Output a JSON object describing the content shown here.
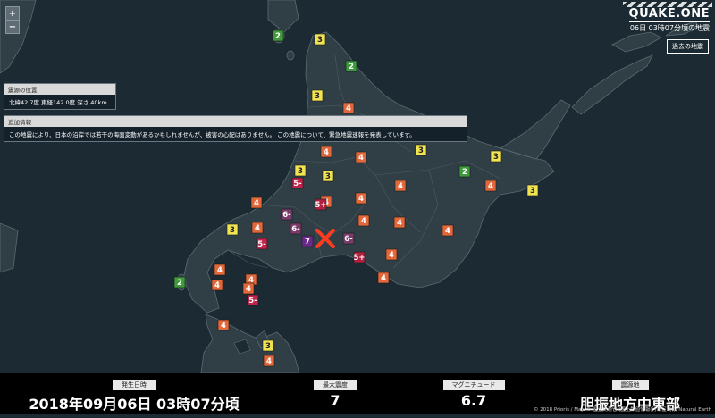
{
  "map": {
    "zoom_in": "+",
    "zoom_out": "−",
    "epicenter_marker": "x-mark-icon",
    "stations": [
      {
        "label": "2",
        "color": "#3e9a3a",
        "text_color": "#ffffff"
      },
      {
        "label": "3",
        "color": "#f2e450",
        "text_color": "#222222"
      },
      {
        "label": "2",
        "color": "#3e9a3a",
        "text_color": "#ffffff"
      },
      {
        "label": "3",
        "color": "#f2e450",
        "text_color": "#222222"
      },
      {
        "label": "4",
        "color": "#e2673b",
        "text_color": "#ffffff"
      },
      {
        "label": "3",
        "color": "#f2e450",
        "text_color": "#222222"
      },
      {
        "label": "4",
        "color": "#e2673b",
        "text_color": "#ffffff"
      },
      {
        "label": "3",
        "color": "#f2e450",
        "text_color": "#222222"
      },
      {
        "label": "4",
        "color": "#e2673b",
        "text_color": "#ffffff"
      },
      {
        "label": "4",
        "color": "#e2673b",
        "text_color": "#ffffff"
      },
      {
        "label": "3",
        "color": "#f2e450",
        "text_color": "#222222"
      },
      {
        "label": "3",
        "color": "#f2e450",
        "text_color": "#222222"
      },
      {
        "label": "2",
        "color": "#3e9a3a",
        "text_color": "#ffffff"
      },
      {
        "label": "3",
        "color": "#f2e450",
        "text_color": "#222222"
      },
      {
        "label": "5-",
        "color": "#c0224a",
        "text_color": "#ffffff"
      },
      {
        "label": "4",
        "color": "#e2673b",
        "text_color": "#ffffff"
      },
      {
        "label": "4",
        "color": "#e2673b",
        "text_color": "#ffffff"
      },
      {
        "label": "4",
        "color": "#e2673b",
        "text_color": "#ffffff"
      },
      {
        "label": "4",
        "color": "#e2673b",
        "text_color": "#ffffff"
      },
      {
        "label": "3",
        "color": "#f2e450",
        "text_color": "#222222"
      },
      {
        "label": "5+",
        "color": "#b02040",
        "text_color": "#ffffff"
      },
      {
        "label": "4",
        "color": "#e2673b",
        "text_color": "#ffffff"
      },
      {
        "label": "4",
        "color": "#e2673b",
        "text_color": "#ffffff"
      },
      {
        "label": "6-",
        "color": "#7a3a6a",
        "text_color": "#ffffff"
      },
      {
        "label": "6-",
        "color": "#7a3a6a",
        "text_color": "#ffffff"
      },
      {
        "label": "7",
        "color": "#6a2a8a",
        "text_color": "#ffffff"
      },
      {
        "label": "6-",
        "color": "#7a3a6a",
        "text_color": "#ffffff"
      },
      {
        "label": "3",
        "color": "#f2e450",
        "text_color": "#222222"
      },
      {
        "label": "4",
        "color": "#e2673b",
        "text_color": "#ffffff"
      },
      {
        "label": "4",
        "color": "#e2673b",
        "text_color": "#ffffff"
      },
      {
        "label": "4",
        "color": "#e2673b",
        "text_color": "#ffffff"
      },
      {
        "label": "5-",
        "color": "#c0224a",
        "text_color": "#ffffff"
      },
      {
        "label": "5+",
        "color": "#b02040",
        "text_color": "#ffffff"
      },
      {
        "label": "4",
        "color": "#e2673b",
        "text_color": "#ffffff"
      },
      {
        "label": "4",
        "color": "#e2673b",
        "text_color": "#ffffff"
      },
      {
        "label": "4",
        "color": "#e2673b",
        "text_color": "#ffffff"
      },
      {
        "label": "4",
        "color": "#e2673b",
        "text_color": "#ffffff"
      },
      {
        "label": "2",
        "color": "#3e9a3a",
        "text_color": "#ffffff"
      },
      {
        "label": "4",
        "color": "#e2673b",
        "text_color": "#ffffff"
      },
      {
        "label": "4",
        "color": "#e2673b",
        "text_color": "#ffffff"
      },
      {
        "label": "5-",
        "color": "#c0224a",
        "text_color": "#ffffff"
      },
      {
        "label": "4",
        "color": "#e2673b",
        "text_color": "#ffffff"
      },
      {
        "label": "3",
        "color": "#f2e450",
        "text_color": "#222222"
      },
      {
        "label": "4",
        "color": "#e2673b",
        "text_color": "#ffffff"
      },
      {
        "label": "3",
        "color": "#f2e450",
        "text_color": "#222222"
      },
      {
        "label": "3",
        "color": "#f2e450",
        "text_color": "#222222"
      }
    ]
  },
  "brand": {
    "title": "QUAKE.ONE",
    "subtitle": "06日 03時07分頃の地震"
  },
  "past_button": "過去の地震",
  "hypocenter_panel": {
    "header": "震源の位置",
    "body": "北緯42.7度 東経142.0度 深さ 40km"
  },
  "info_panel": {
    "header": "追加情報",
    "body": "この地震により、日本の沿岸では若干の海面変動があるかもしれませんが、被害の心配はありません。 この地震について、緊急地震速報を発表しています。"
  },
  "summary": {
    "occurred_label": "発生日時",
    "occurred_value": "2018年09月06日 03時07分頃",
    "max_intensity_label": "最大震度",
    "max_intensity_value": "7",
    "magnitude_label": "マグニチュード",
    "magnitude_value": "6.7",
    "epicenter_label": "震源地",
    "epicenter_value": "胆振地方中東部"
  },
  "credit": "© 2018 Prioris / Map © 国土交通省 (国土数値情報(行政区域)), Natural Earth",
  "colors": {
    "sea": "#1c2b33",
    "land": "#2f3f45",
    "land_border": "#5b6a70",
    "epicenter": "#ff3b1f"
  }
}
